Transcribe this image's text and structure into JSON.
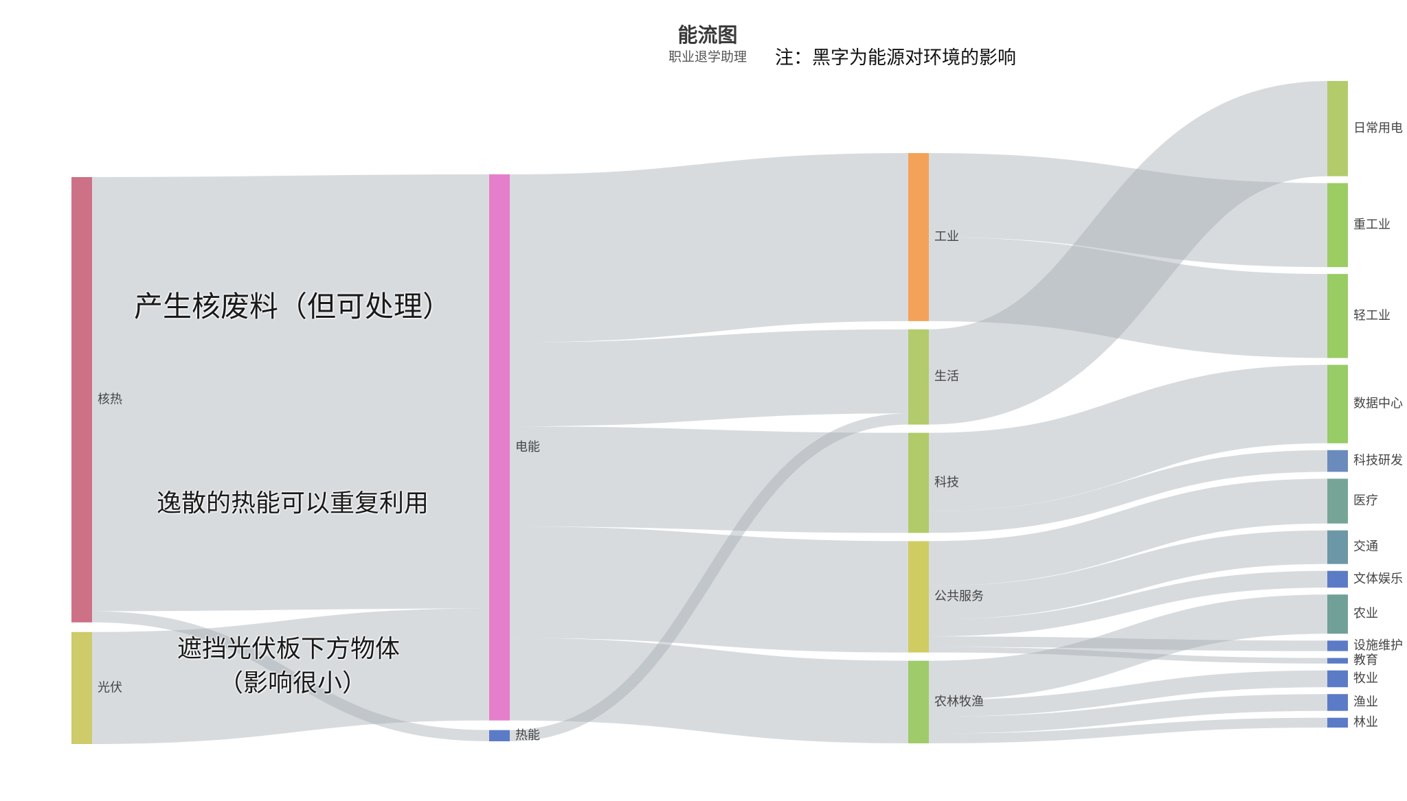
{
  "title": "能流图",
  "subtitle": "职业退学助理",
  "note": "注：黑字为能源对环境的影响",
  "annotations": {
    "nuclear_waste": "产生核废料（但可处理）",
    "heat_reuse": "逸散的热能可以重复利用",
    "pv_line1": "遮挡光伏板下方物体",
    "pv_line2": "（影响很小）"
  },
  "nodes": [
    {
      "id": "nuclear",
      "label": "核热",
      "column": 0,
      "color": "#cd7186"
    },
    {
      "id": "pv",
      "label": "光伏",
      "column": 0,
      "color": "#cdcb6a"
    },
    {
      "id": "elec",
      "label": "电能",
      "column": 1,
      "color": "#e67fcb"
    },
    {
      "id": "heat",
      "label": "热能",
      "column": 1,
      "color": "#5b7bc6"
    },
    {
      "id": "industry",
      "label": "工业",
      "column": 2,
      "color": "#f4a25a"
    },
    {
      "id": "life",
      "label": "生活",
      "column": 2,
      "color": "#b3cb6c"
    },
    {
      "id": "tech",
      "label": "科技",
      "column": 2,
      "color": "#b1ca6a"
    },
    {
      "id": "public",
      "label": "公共服务",
      "column": 2,
      "color": "#cfcc62"
    },
    {
      "id": "agri_all",
      "label": "农林牧渔",
      "column": 2,
      "color": "#9fcb6a"
    },
    {
      "id": "daily",
      "label": "日常用电",
      "column": 3,
      "color": "#b4cb6b"
    },
    {
      "id": "heavy",
      "label": "重工业",
      "column": 3,
      "color": "#9ccd63"
    },
    {
      "id": "light",
      "label": "轻工业",
      "column": 3,
      "color": "#99cc63"
    },
    {
      "id": "datacenter",
      "label": "数据中心",
      "column": 3,
      "color": "#97cc66"
    },
    {
      "id": "rnd",
      "label": "科技研发",
      "column": 3,
      "color": "#6b8bbd"
    },
    {
      "id": "medical",
      "label": "医疗",
      "column": 3,
      "color": "#76a597"
    },
    {
      "id": "traffic",
      "label": "交通",
      "column": 3,
      "color": "#6c97a6"
    },
    {
      "id": "culture",
      "label": "文体娱乐",
      "column": 3,
      "color": "#5b7bc6"
    },
    {
      "id": "farming",
      "label": "农业",
      "column": 3,
      "color": "#71a098"
    },
    {
      "id": "maint",
      "label": "设施维护",
      "column": 3,
      "color": "#5b7bc6"
    },
    {
      "id": "edu",
      "label": "教育",
      "column": 3,
      "color": "#5b7bc6"
    },
    {
      "id": "herding",
      "label": "牧业",
      "column": 3,
      "color": "#5b7bc6"
    },
    {
      "id": "fishing",
      "label": "渔业",
      "column": 3,
      "color": "#5b7bc6"
    },
    {
      "id": "forestry",
      "label": "林业",
      "column": 3,
      "color": "#5b7bc6"
    }
  ],
  "links": [
    {
      "source": "nuclear",
      "target": "elec",
      "value": 620
    },
    {
      "source": "nuclear",
      "target": "heat",
      "value": 16
    },
    {
      "source": "pv",
      "target": "elec",
      "value": 160
    },
    {
      "source": "elec",
      "target": "industry",
      "value": 240
    },
    {
      "source": "elec",
      "target": "life",
      "value": 120
    },
    {
      "source": "elec",
      "target": "tech",
      "value": 143
    },
    {
      "source": "elec",
      "target": "public",
      "value": 159
    },
    {
      "source": "elec",
      "target": "agri_all",
      "value": 118
    },
    {
      "source": "heat",
      "target": "life",
      "value": 16
    },
    {
      "source": "industry",
      "target": "heavy",
      "value": 120
    },
    {
      "source": "industry",
      "target": "light",
      "value": 120
    },
    {
      "source": "life",
      "target": "daily",
      "value": 136
    },
    {
      "source": "tech",
      "target": "datacenter",
      "value": 112
    },
    {
      "source": "tech",
      "target": "rnd",
      "value": 31
    },
    {
      "source": "public",
      "target": "medical",
      "value": 64
    },
    {
      "source": "public",
      "target": "traffic",
      "value": 48
    },
    {
      "source": "public",
      "target": "culture",
      "value": 24
    },
    {
      "source": "public",
      "target": "maint",
      "value": 15
    },
    {
      "source": "public",
      "target": "edu",
      "value": 8
    },
    {
      "source": "agri_all",
      "target": "farming",
      "value": 56
    },
    {
      "source": "agri_all",
      "target": "herding",
      "value": 24
    },
    {
      "source": "agri_all",
      "target": "fishing",
      "value": 24
    },
    {
      "source": "agri_all",
      "target": "forestry",
      "value": 14
    }
  ]
}
